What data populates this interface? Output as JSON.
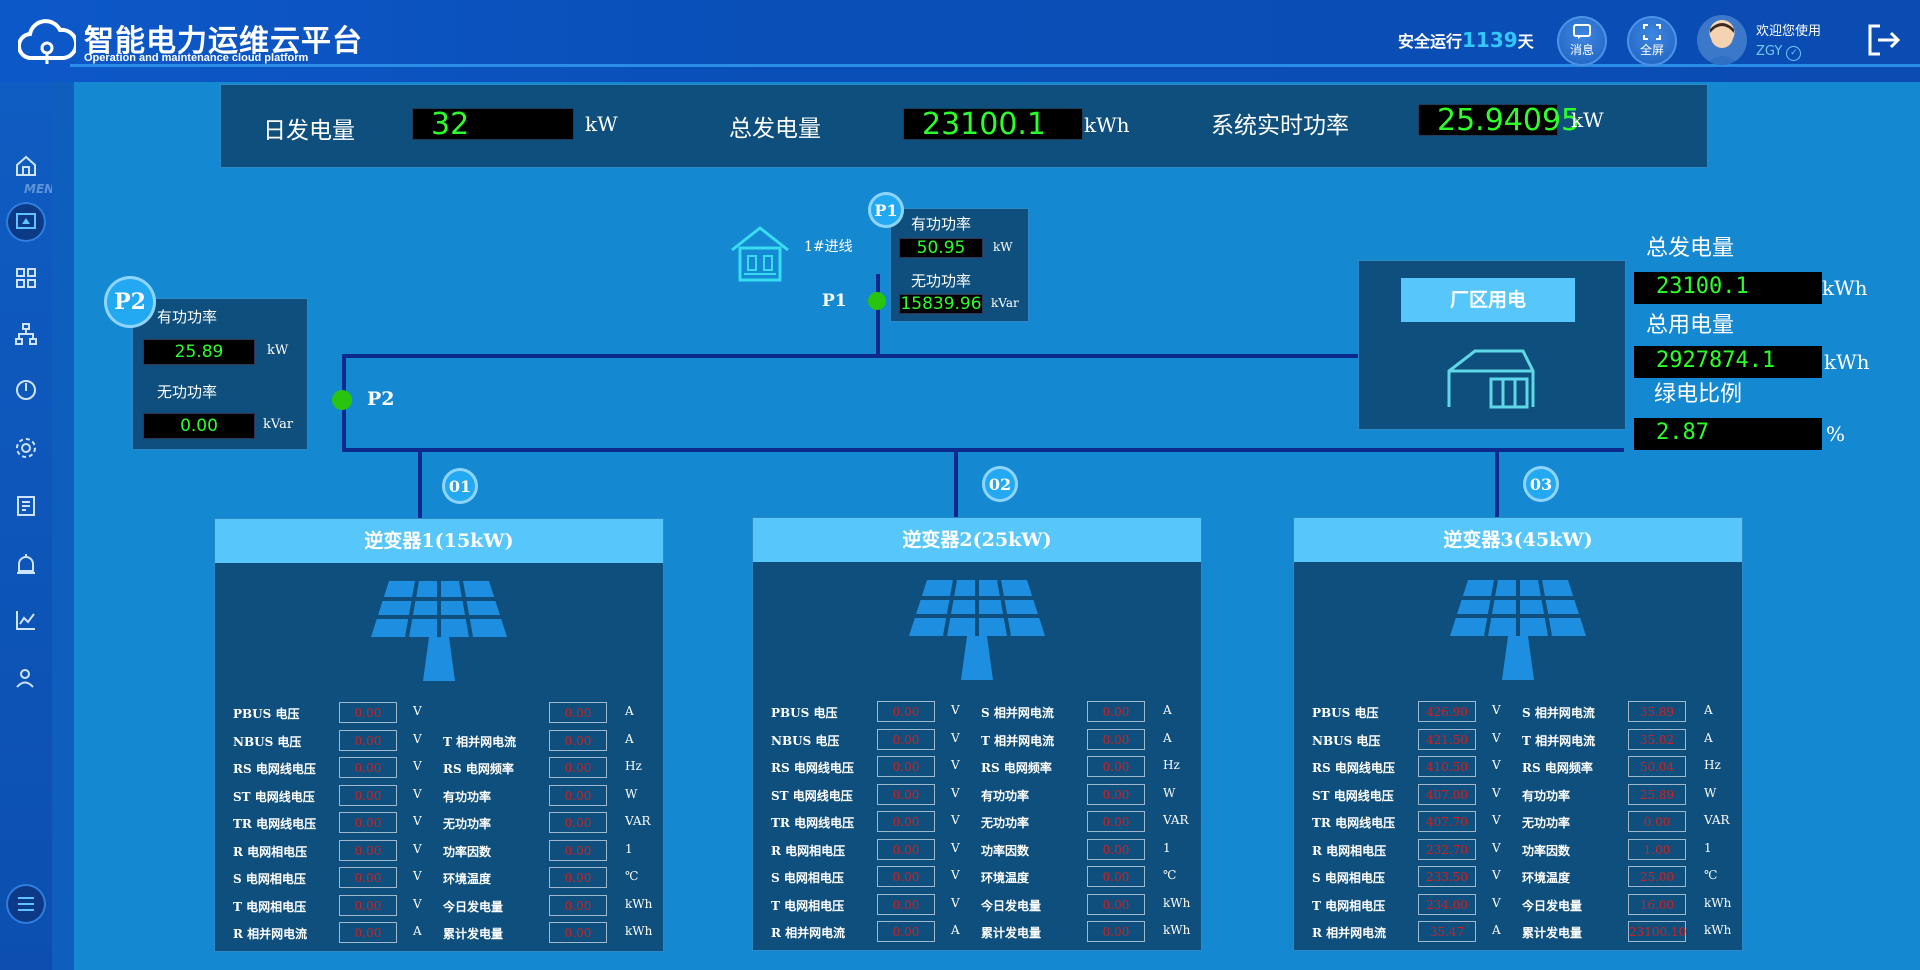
{
  "header": {
    "title": "智能电力运维云平台",
    "subtitle": "Operation and maintenance cloud platform",
    "safety_prefix": "安全运行",
    "safety_days": "1139",
    "safety_suffix": "天",
    "btn_message": "消息",
    "btn_fullscreen": "全屏",
    "welcome": "欢迎您使用",
    "username": "ZGY"
  },
  "sidebar": {
    "menu_label": "MEN",
    "items": [
      "home-icon",
      "monitor-icon",
      "grid-icon",
      "topology-icon",
      "power-icon",
      "gear-icon",
      "report-icon",
      "alarm-icon",
      "chart-icon",
      "user-icon",
      "menu-icon"
    ]
  },
  "kpi": {
    "daily_label": "日发电量",
    "daily_value": "32",
    "daily_unit": "kW",
    "total_label": "总发电量",
    "total_value": "23100.1",
    "total_unit": "kWh",
    "power_label": "系统实时功率",
    "power_value": "25.94095",
    "power_unit": "kW"
  },
  "p1": {
    "badge": "P1",
    "incoming_label": "1#进线",
    "node_label": "P1",
    "active_label": "有功功率",
    "active_value": "50.95",
    "active_unit": "kW",
    "reactive_label": "无功功率",
    "reactive_value": "15839.96",
    "reactive_unit": "kVar"
  },
  "p2": {
    "badge": "P2",
    "node_label": "P2",
    "active_label": "有功功率",
    "active_value": "25.89",
    "active_unit": "kW",
    "reactive_label": "无功功率",
    "reactive_value": "0.00",
    "reactive_unit": "kVar"
  },
  "factory": {
    "title": "厂区用电",
    "total_gen_label": "总发电量",
    "total_gen_value": "23100.1",
    "total_gen_unit": "kWh",
    "total_use_label": "总用电量",
    "total_use_value": "2927874.1",
    "total_use_unit": "kWh",
    "green_label": "绿电比例",
    "green_value": "2.87",
    "green_unit": "%"
  },
  "branches": [
    "01",
    "02",
    "03"
  ],
  "inverters": [
    {
      "title": "逆变器1(15kW)",
      "left": [
        {
          "label": "PBUS 电压",
          "value": "0.00",
          "unit": "V"
        },
        {
          "label": "NBUS 电压",
          "value": "0.00",
          "unit": "V"
        },
        {
          "label": "RS 电网线电压",
          "value": "0.00",
          "unit": "V"
        },
        {
          "label": "ST 电网线电压",
          "value": "0.00",
          "unit": "V"
        },
        {
          "label": "TR 电网线电压",
          "value": "0.00",
          "unit": "V"
        },
        {
          "label": "R 电网相电压",
          "value": "0.00",
          "unit": "V"
        },
        {
          "label": "S 电网相电压",
          "value": "0.00",
          "unit": "V"
        },
        {
          "label": "T 电网相电压",
          "value": "0.00",
          "unit": "V"
        },
        {
          "label": "R 相并网电流",
          "value": "0.00",
          "unit": "A"
        }
      ],
      "right": [
        {
          "label": "",
          "value": "0.00",
          "unit": "A"
        },
        {
          "label": "T 相并网电流",
          "value": "0.00",
          "unit": "A"
        },
        {
          "label": "RS 电网频率",
          "value": "0.00",
          "unit": "Hz"
        },
        {
          "label": "有功功率",
          "value": "0.00",
          "unit": "W"
        },
        {
          "label": "无功功率",
          "value": "0.00",
          "unit": "VAR"
        },
        {
          "label": "功率因数",
          "value": "0.00",
          "unit": "1"
        },
        {
          "label": "环境温度",
          "value": "0.00",
          "unit": "℃"
        },
        {
          "label": "今日发电量",
          "value": "0.00",
          "unit": "kWh"
        },
        {
          "label": "累计发电量",
          "value": "0.00",
          "unit": "kWh"
        }
      ]
    },
    {
      "title": "逆变器2(25kW)",
      "left": [
        {
          "label": "PBUS 电压",
          "value": "0.00",
          "unit": "V"
        },
        {
          "label": "NBUS 电压",
          "value": "0.00",
          "unit": "V"
        },
        {
          "label": "RS 电网线电压",
          "value": "0.00",
          "unit": "V"
        },
        {
          "label": "ST 电网线电压",
          "value": "0.00",
          "unit": "V"
        },
        {
          "label": "TR 电网线电压",
          "value": "0.00",
          "unit": "V"
        },
        {
          "label": "R 电网相电压",
          "value": "0.00",
          "unit": "V"
        },
        {
          "label": "S 电网相电压",
          "value": "0.00",
          "unit": "V"
        },
        {
          "label": "T 电网相电压",
          "value": "0.00",
          "unit": "V"
        },
        {
          "label": "R 相并网电流",
          "value": "0.00",
          "unit": "A"
        }
      ],
      "right": [
        {
          "label": "S 相并网电流",
          "value": "0.00",
          "unit": "A"
        },
        {
          "label": "T 相并网电流",
          "value": "0.00",
          "unit": "A"
        },
        {
          "label": "RS 电网频率",
          "value": "0.00",
          "unit": "Hz"
        },
        {
          "label": "有功功率",
          "value": "0.00",
          "unit": "W"
        },
        {
          "label": "无功功率",
          "value": "0.00",
          "unit": "VAR"
        },
        {
          "label": "功率因数",
          "value": "0.00",
          "unit": "1"
        },
        {
          "label": "环境温度",
          "value": "0.00",
          "unit": "℃"
        },
        {
          "label": "今日发电量",
          "value": "0.00",
          "unit": "kWh"
        },
        {
          "label": "累计发电量",
          "value": "0.00",
          "unit": "kWh"
        }
      ]
    },
    {
      "title": "逆变器3(45kW)",
      "left": [
        {
          "label": "PBUS 电压",
          "value": "426.90",
          "unit": "V"
        },
        {
          "label": "NBUS 电压",
          "value": "421.50",
          "unit": "V"
        },
        {
          "label": "RS 电网线电压",
          "value": "410.50",
          "unit": "V"
        },
        {
          "label": "ST 电网线电压",
          "value": "407.00",
          "unit": "V"
        },
        {
          "label": "TR 电网线电压",
          "value": "407.70",
          "unit": "V"
        },
        {
          "label": "R 电网相电压",
          "value": "232.70",
          "unit": "V"
        },
        {
          "label": "S 电网相电压",
          "value": "233.50",
          "unit": "V"
        },
        {
          "label": "T 电网相电压",
          "value": "234.00",
          "unit": "V"
        },
        {
          "label": "R 相并网电流",
          "value": "35.47",
          "unit": "A"
        }
      ],
      "right": [
        {
          "label": "S 相并网电流",
          "value": "35.89",
          "unit": "A"
        },
        {
          "label": "T 相并网电流",
          "value": "35.02",
          "unit": "A"
        },
        {
          "label": "RS 电网频率",
          "value": "50.04",
          "unit": "Hz"
        },
        {
          "label": "有功功率",
          "value": "25.89",
          "unit": "W"
        },
        {
          "label": "无功功率",
          "value": "0.00",
          "unit": "VAR"
        },
        {
          "label": "功率因数",
          "value": "1.00",
          "unit": "1"
        },
        {
          "label": "环境温度",
          "value": "25.00",
          "unit": "℃"
        },
        {
          "label": "今日发电量",
          "value": "16.00",
          "unit": "kWh"
        },
        {
          "label": "累计发电量",
          "value": "23100.10",
          "unit": "kWh"
        }
      ]
    }
  ]
}
